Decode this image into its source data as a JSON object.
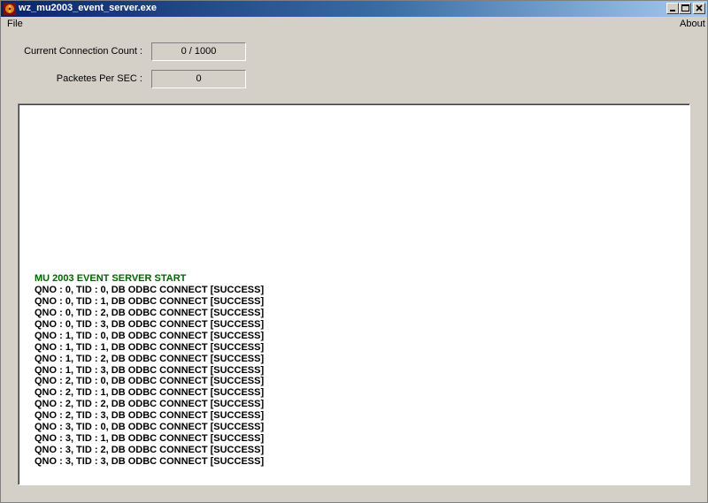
{
  "window": {
    "title": "wz_mu2003_event_server.exe"
  },
  "menu": {
    "file": "File",
    "about": "About"
  },
  "stats": {
    "connection_label": "Current Connection Count :",
    "connection_value": "0 / 1000",
    "pps_label": "Packetes Per SEC :",
    "pps_value": "0"
  },
  "log": {
    "lines": [
      {
        "text": "MU 2003 EVENT SERVER START",
        "color": "#006400"
      },
      {
        "text": "QNO : 0, TID : 0, DB ODBC CONNECT [SUCCESS]",
        "color": "#000000"
      },
      {
        "text": "QNO : 0, TID : 1, DB ODBC CONNECT [SUCCESS]",
        "color": "#000000"
      },
      {
        "text": "QNO : 0, TID : 2, DB ODBC CONNECT [SUCCESS]",
        "color": "#000000"
      },
      {
        "text": "QNO : 0, TID : 3, DB ODBC CONNECT [SUCCESS]",
        "color": "#000000"
      },
      {
        "text": "QNO : 1, TID : 0, DB ODBC CONNECT [SUCCESS]",
        "color": "#000000"
      },
      {
        "text": "QNO : 1, TID : 1, DB ODBC CONNECT [SUCCESS]",
        "color": "#000000"
      },
      {
        "text": "QNO : 1, TID : 2, DB ODBC CONNECT [SUCCESS]",
        "color": "#000000"
      },
      {
        "text": "QNO : 1, TID : 3, DB ODBC CONNECT [SUCCESS]",
        "color": "#000000"
      },
      {
        "text": "QNO : 2, TID : 0, DB ODBC CONNECT [SUCCESS]",
        "color": "#000000"
      },
      {
        "text": "QNO : 2, TID : 1, DB ODBC CONNECT [SUCCESS]",
        "color": "#000000"
      },
      {
        "text": "QNO : 2, TID : 2, DB ODBC CONNECT [SUCCESS]",
        "color": "#000000"
      },
      {
        "text": "QNO : 2, TID : 3, DB ODBC CONNECT [SUCCESS]",
        "color": "#000000"
      },
      {
        "text": "QNO : 3, TID : 0, DB ODBC CONNECT [SUCCESS]",
        "color": "#000000"
      },
      {
        "text": "QNO : 3, TID : 1, DB ODBC CONNECT [SUCCESS]",
        "color": "#000000"
      },
      {
        "text": "QNO : 3, TID : 2, DB ODBC CONNECT [SUCCESS]",
        "color": "#000000"
      },
      {
        "text": "QNO : 3, TID : 3, DB ODBC CONNECT [SUCCESS]",
        "color": "#000000"
      }
    ]
  },
  "icons": {
    "app": "app-icon",
    "minimize": "minimize-icon",
    "maximize": "maximize-icon",
    "close": "close-icon"
  }
}
